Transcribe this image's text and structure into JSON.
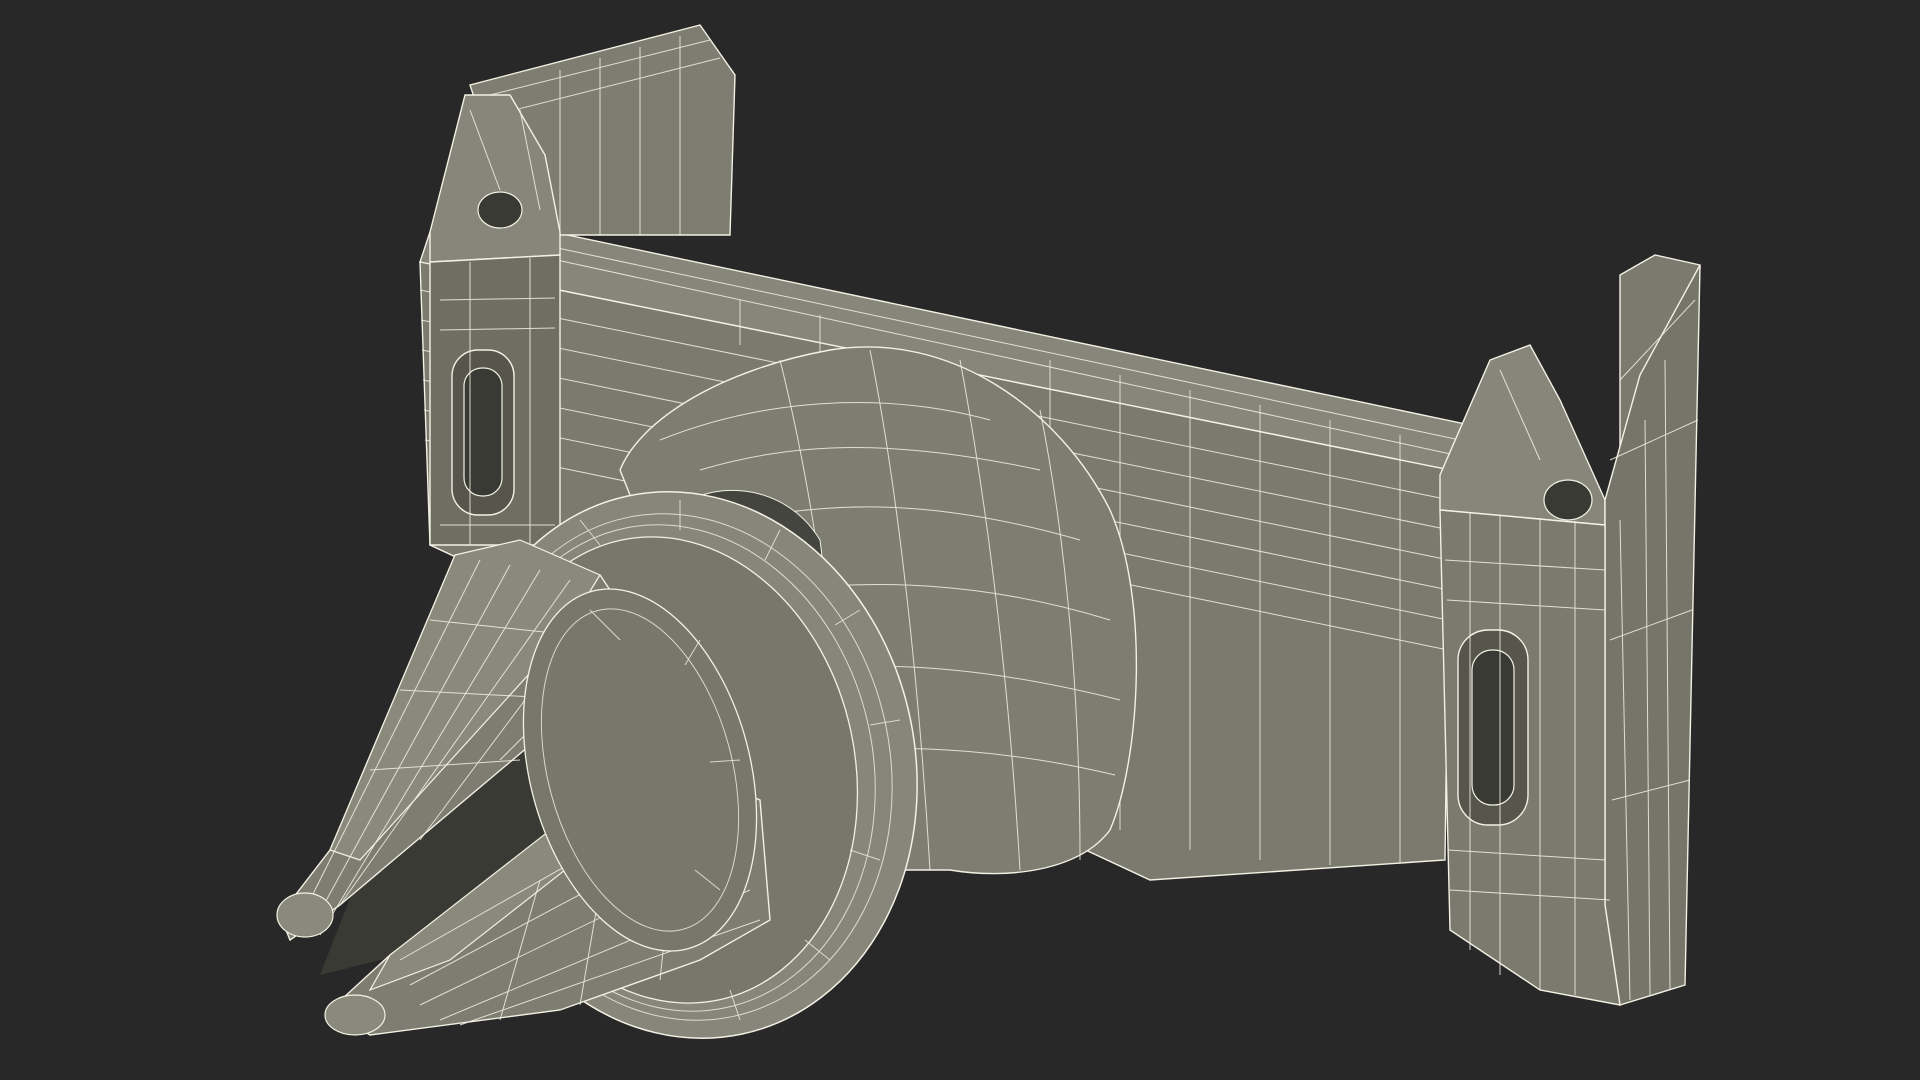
{
  "scene": {
    "subject": "car-vent-phone-mount-wireframe",
    "colors": {
      "background": "#282828",
      "body": "#7a7a6e",
      "body_light": "#8a8a7c",
      "body_dark": "#5f5f55",
      "shadow": "#45453f",
      "slot": "#3a3a34",
      "wire": "#f3f1e4"
    }
  }
}
